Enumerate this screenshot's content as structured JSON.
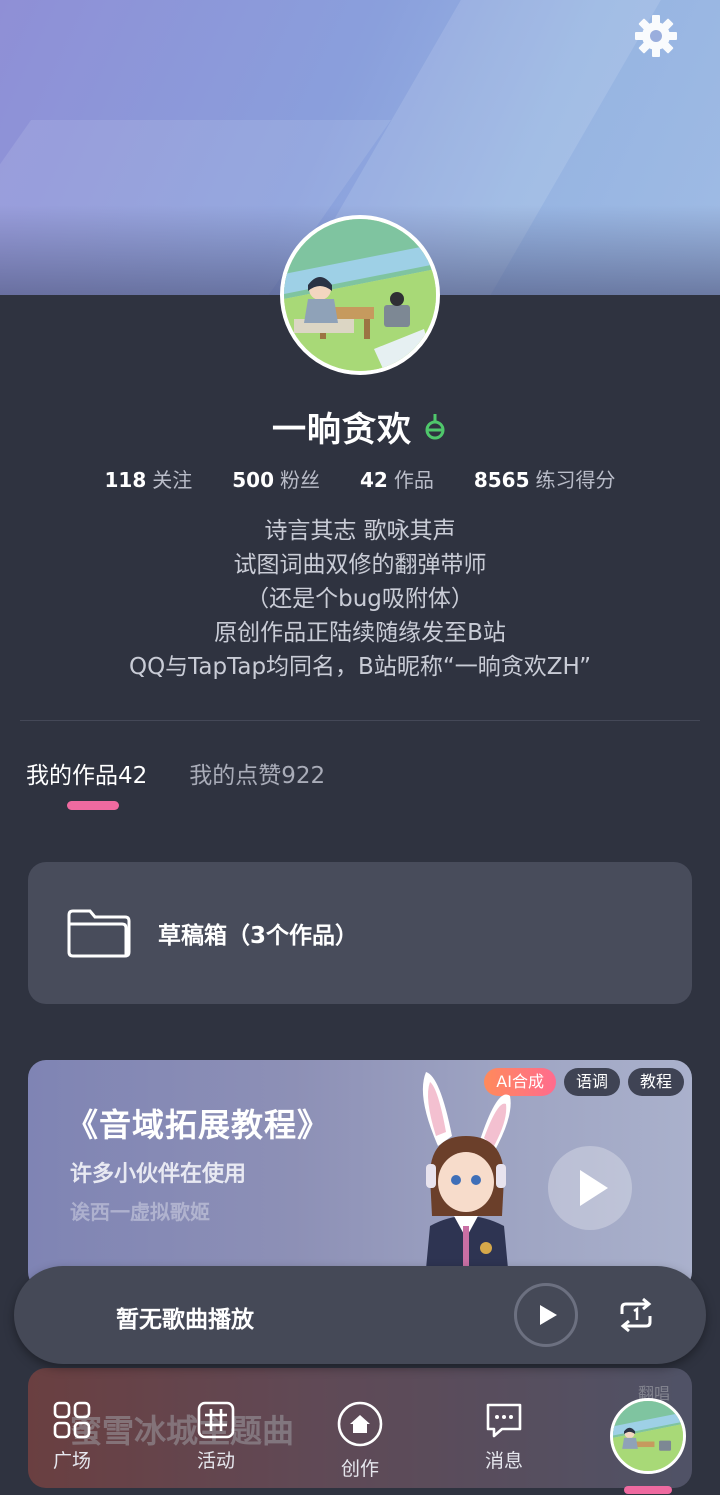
{
  "profile": {
    "username": "一晌贪欢",
    "stats": [
      {
        "num": "118",
        "label": "关注"
      },
      {
        "num": "500",
        "label": "粉丝"
      },
      {
        "num": "42",
        "label": "作品"
      },
      {
        "num": "8565",
        "label": "练习得分"
      }
    ],
    "bio": [
      "诗言其志 歌咏其声",
      "试图词曲双修的翻弹带师",
      "（还是个bug吸附体）",
      "原创作品正陆续随缘发至B站",
      "QQ与TapTap均同名，B站昵称“一晌贪欢ZH”"
    ]
  },
  "tabs": [
    {
      "label": "我的作品42",
      "active": true
    },
    {
      "label": "我的点赞922",
      "active": false
    }
  ],
  "drafts": {
    "label": "草稿箱（3个作品）"
  },
  "banner": {
    "title": "《音域拓展教程》",
    "subtitle": "许多小伙伴在使用",
    "author": "诶西一虚拟歌姬",
    "tags": [
      "AI合成",
      "语调",
      "教程"
    ]
  },
  "second_card": {
    "title": "蜜雪冰城主题曲",
    "tag": "翻唱"
  },
  "player": {
    "label": "暂无歌曲播放"
  },
  "nav": [
    {
      "label": "广场",
      "icon": "grid-icon"
    },
    {
      "label": "活动",
      "icon": "hash-icon"
    },
    {
      "label": "创作",
      "icon": "home-circle-icon"
    },
    {
      "label": "消息",
      "icon": "message-icon"
    }
  ],
  "colors": {
    "background": "#2f3340",
    "accent_pink": "#ef6aa0",
    "card": "#484c5b",
    "gender_green": "#4fc76b"
  }
}
